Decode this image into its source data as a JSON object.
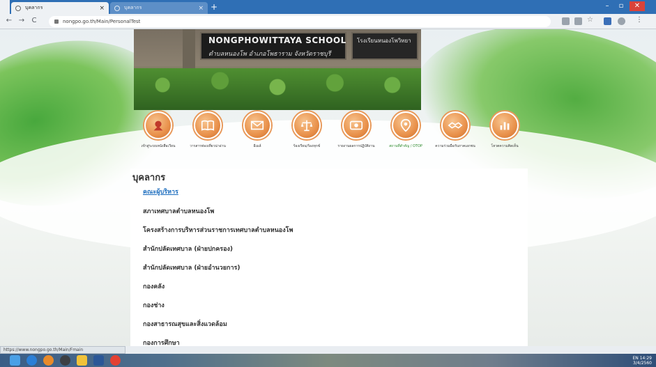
{
  "browser": {
    "tabs": [
      {
        "label": "บุคลากร"
      },
      {
        "label": "บุคลากร"
      }
    ],
    "new_tab": "+",
    "url": "nongpo.go.th/Main/PersonalTest",
    "win_minimize": "–",
    "win_maximize": "▫",
    "win_close": "✕",
    "back": "←",
    "forward": "→",
    "reload": "C"
  },
  "banner": {
    "sign_en": "NONGPHOWITTAYA SCHOOL",
    "sign_th": "ตำบลหนองโพ อำเภอโพธาราม จังหวัดราชบุรี",
    "sign_right": "โรงเรียนหนองโพวิทยา"
  },
  "icons": [
    {
      "name": "emblem-icon",
      "label": "เข้าสู่ระบบหนังสือเวียน"
    },
    {
      "name": "book-icon",
      "label": "วารสารท่องเที่ยวน่าอ่าน"
    },
    {
      "name": "mail-icon",
      "label": "อีเมล์"
    },
    {
      "name": "scales-icon",
      "label": "ร้องเรียน/ร้องทุกข์"
    },
    {
      "name": "media-icon",
      "label": "รายงานผลการปฏิบัติงาน"
    },
    {
      "name": "pin-icon",
      "label": "สถานที่สำคัญ / OTOP"
    },
    {
      "name": "handshake-icon",
      "label": "ความร่วมมือกับภาคเอกชน"
    },
    {
      "name": "chart-icon",
      "label": "โหวตความคิดเห็น"
    }
  ],
  "content": {
    "title": "บุคลากร",
    "link": "คณะผู้บริหาร",
    "items": [
      "สภาเทศบาลตำบลหนองโพ",
      "โครงสร้างการบริหารส่วนราชการเทศบาลตำบลหนองโพ",
      "สำนักปลัดเทศบาล (ฝ่ายปกครอง)",
      "สำนักปลัดเทศบาล (ฝ่ายอำนวยการ)",
      "กองคลัง",
      "กองช่าง",
      "กองสาธารณสุขและสิ่งแวดล้อม",
      "กองการศึกษา"
    ]
  },
  "status_link": "https://www.nongpo.go.th/Main/Fmain",
  "taskbar": {
    "tray_lang": "EN",
    "tray_time": "14:29",
    "tray_date": "3/4/2560"
  }
}
